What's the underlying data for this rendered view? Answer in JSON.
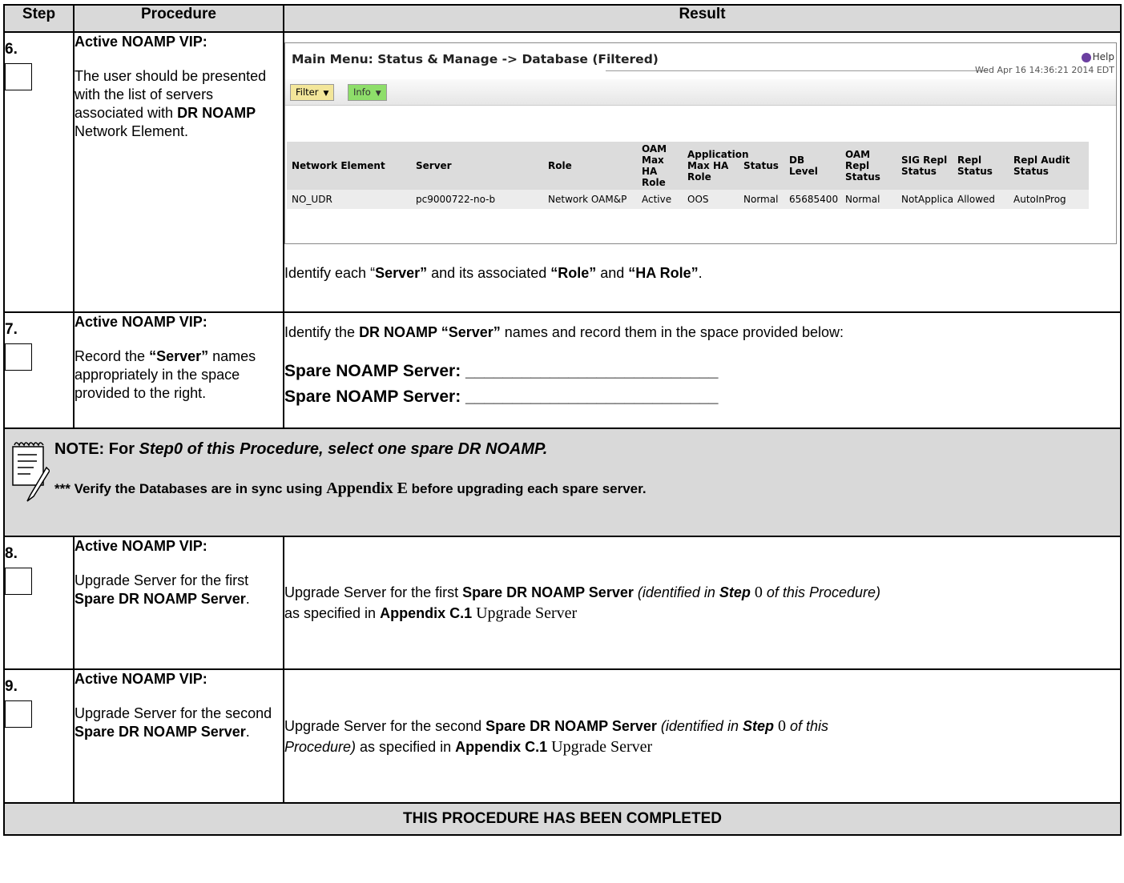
{
  "header": {
    "step": "Step",
    "procedure": "Procedure",
    "result": "Result"
  },
  "step6": {
    "number": "6.",
    "title": "Active NOAMP VIP:",
    "desc_a": "The user should be presented with the list of servers associated with ",
    "desc_b": "DR NOAMP",
    "desc_c": " Network Element.",
    "gui": {
      "menu_title": "Main Menu: Status & Manage -> Database (Filtered)",
      "help": "Help",
      "timestamp": "Wed Apr 16 14:36:21 2014 EDT",
      "filter": "Filter",
      "info": "Info",
      "columns": [
        "Network Element",
        "Server",
        "Role",
        "OAM Max HA Role",
        "Application Max HA Role",
        "Status",
        "DB Level",
        "OAM Repl Status",
        "SIG Repl Status",
        "Repl Status",
        "Repl Audit Status"
      ],
      "row": [
        "NO_UDR",
        "pc9000722-no-b",
        "Network OAM&P",
        "Active",
        "OOS",
        "Normal",
        "65685400",
        "Normal",
        "NotApplicab",
        "Allowed",
        "AutoInProg"
      ]
    },
    "identify_a": "Identify each “",
    "identify_b": "Server”",
    "identify_c": " and its associated ",
    "identify_d": "“Role”",
    "identify_e": " and ",
    "identify_f": "“HA Role”",
    "identify_g": "."
  },
  "step7": {
    "number": "7.",
    "title": "Active NOAMP VIP:",
    "desc_a": "Record the ",
    "desc_b": "“Server”",
    "desc_c": " names appropriately in the space provided to the right.",
    "result_a": "Identify the ",
    "result_b": "DR NOAMP “Server”",
    "result_c": " names and record them in the space provided below:",
    "spare1": "Spare NOAMP Server: ___________________________",
    "spare2": "Spare NOAMP Server: ___________________________"
  },
  "note": {
    "line1_a": "NOTE:  For ",
    "line1_b": "Step0 of this Procedure, select one spare DR NOAMP.",
    "line2_a": "*** Verify the Databases are in sync using ",
    "line2_b": "Appendix E",
    "line2_c": " before upgrading each spare server."
  },
  "step8": {
    "number": "8.",
    "title": "Active NOAMP VIP:",
    "desc_a": "Upgrade Server for the first ",
    "desc_b": "Spare DR NOAMP Server",
    "desc_c": ".",
    "result_a": "Upgrade Server for the first ",
    "result_b": "Spare DR NOAMP Server",
    "result_c": " (identified in ",
    "result_d": "Step",
    "result_e": " 0",
    "result_f": " of this Procedure)",
    "result_g": "as specified in ",
    "result_h": "Appendix C.1",
    "result_i": " Upgrade Server"
  },
  "step9": {
    "number": "9.",
    "title": "Active NOAMP VIP:",
    "desc_a": "Upgrade Server for the second ",
    "desc_b": "Spare DR NOAMP Server",
    "desc_c": ".",
    "result_a": "Upgrade Server for the second ",
    "result_b": "Spare DR NOAMP Server",
    "result_c": " (identified in ",
    "result_d": "Step",
    "result_e": " 0",
    "result_f": " of this",
    "result_g": "Procedure)",
    "result_h": " as specified in ",
    "result_i": "Appendix C.1",
    "result_j": " Upgrade Server"
  },
  "footer": "THIS PROCEDURE HAS BEEN COMPLETED",
  "colors": {
    "header_bg": "#d9d9d9",
    "filter_btn": "#f3e69a",
    "info_btn": "#8ede6a"
  }
}
